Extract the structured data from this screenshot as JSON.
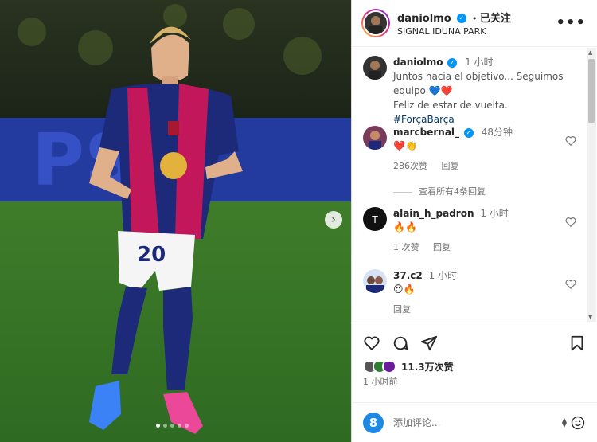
{
  "post": {
    "username": "daniolmo",
    "follow_label": "已关注",
    "location": "SIGNAL IDUNA PARK",
    "more_label": "•••",
    "caption_time": "1 小时",
    "caption_line1": "Juntos hacia el objetivo... Seguimos equipo 💙❤️",
    "caption_line2_text": "Feliz de estar de vuelta.",
    "caption_hashtag": "#ForçaBarça",
    "jersey_number": "20"
  },
  "comments": [
    {
      "user": "marcbernal_",
      "verified": true,
      "time": "48分钟",
      "text": "❤️👏",
      "likes": "286次赞",
      "reply": "回复"
    },
    {
      "user": "alain_h_padron",
      "verified": false,
      "time": "1 小时",
      "text": "🔥🔥",
      "likes": "1 次赞",
      "reply": "回复"
    },
    {
      "user": "37.c2",
      "verified": false,
      "time": "1 小时",
      "text": "😍🔥",
      "likes": "",
      "reply": "回复"
    }
  ],
  "view_replies": "查看所有4条回复",
  "likes_count": "11.3万次赞",
  "posted_ago": "1 小时前",
  "comment_box": {
    "placeholder": "添加评论...",
    "app_icon": "8"
  },
  "icons": [
    "heart-icon",
    "comment-icon",
    "share-icon",
    "save-icon",
    "emoji-icon",
    "chevron-right-icon"
  ],
  "colors": {
    "verified": "#0095f6",
    "hashtag": "#00376b",
    "barca_blue": "#1d2a7a",
    "barca_pink": "#c2185b"
  }
}
